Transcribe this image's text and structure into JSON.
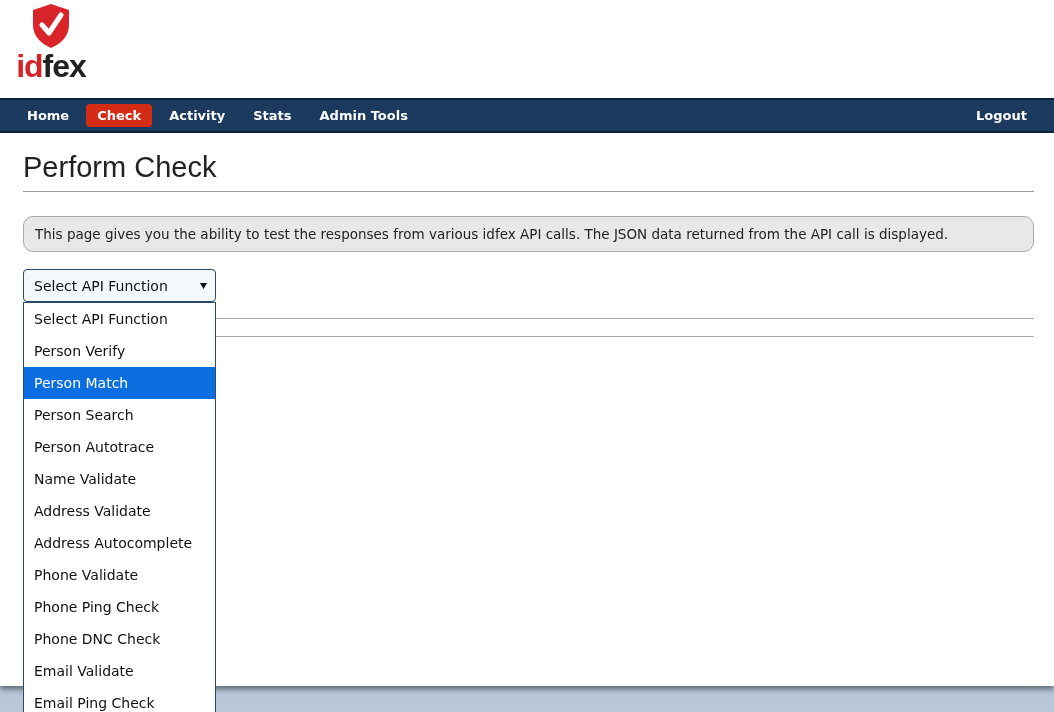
{
  "logo": {
    "prefix": "id",
    "suffix": "fex"
  },
  "nav": {
    "items": [
      {
        "label": "Home",
        "selected": false
      },
      {
        "label": "Check",
        "selected": true
      },
      {
        "label": "Activity",
        "selected": false
      },
      {
        "label": "Stats",
        "selected": false
      },
      {
        "label": "Admin Tools",
        "selected": false
      }
    ],
    "logout": "Logout"
  },
  "page_title": "Perform Check",
  "info": "This page gives you the ability to test the responses from various idfex API calls. The JSON data returned from the API call is displayed.",
  "select": {
    "value": "Select API Function",
    "expanded": true,
    "options": [
      {
        "label": "Select API Function",
        "highlighted": false
      },
      {
        "label": "Person Verify",
        "highlighted": false
      },
      {
        "label": "Person Match",
        "highlighted": true
      },
      {
        "label": "Person Search",
        "highlighted": false
      },
      {
        "label": "Person Autotrace",
        "highlighted": false
      },
      {
        "label": "Name Validate",
        "highlighted": false
      },
      {
        "label": "Address Validate",
        "highlighted": false
      },
      {
        "label": "Address Autocomplete",
        "highlighted": false
      },
      {
        "label": "Phone Validate",
        "highlighted": false
      },
      {
        "label": "Phone Ping Check",
        "highlighted": false
      },
      {
        "label": "Phone DNC Check",
        "highlighted": false
      },
      {
        "label": "Email Validate",
        "highlighted": false
      },
      {
        "label": "Email Ping Check",
        "highlighted": false
      }
    ]
  }
}
